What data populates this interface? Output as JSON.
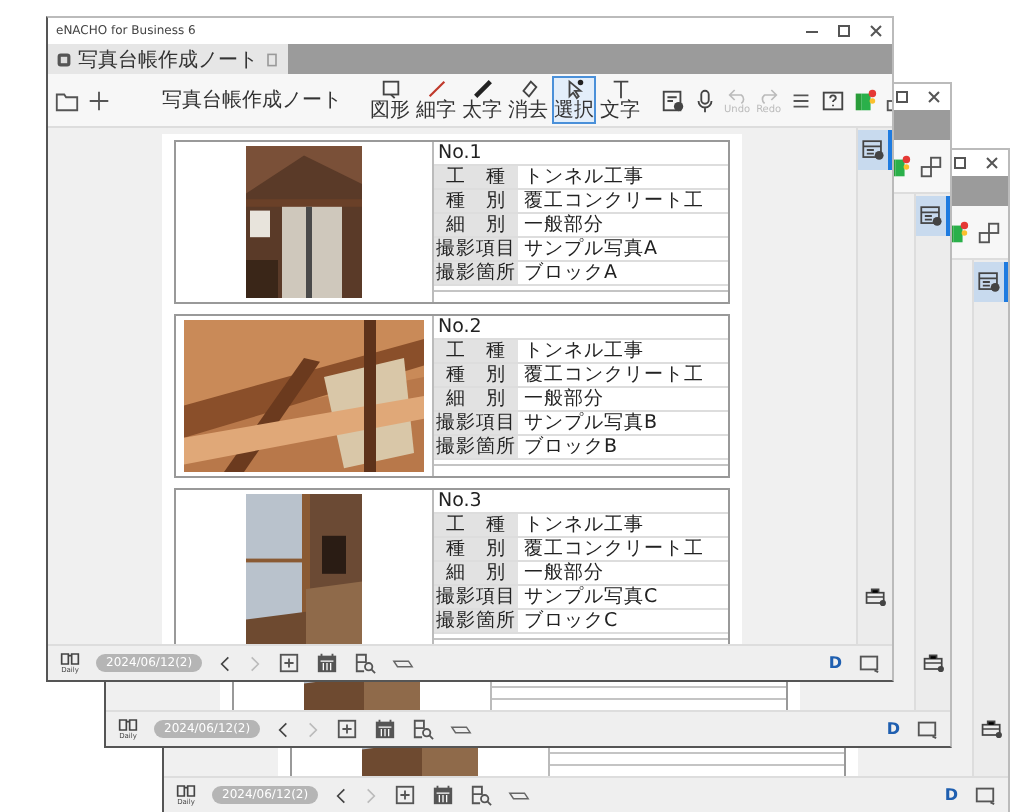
{
  "app_title": "eNACHO for Business 6",
  "tab": {
    "label": "写真台帳作成ノート"
  },
  "toolbar": {
    "title": "写真台帳作成ノート",
    "tools": [
      {
        "label": "図形",
        "selected": false
      },
      {
        "label": "細字",
        "selected": false
      },
      {
        "label": "太字",
        "selected": false
      },
      {
        "label": "消去",
        "selected": false
      },
      {
        "label": "選択",
        "selected": true
      },
      {
        "label": "文字",
        "selected": false
      }
    ],
    "undo": {
      "label": "Undo",
      "disabled": true
    },
    "redo": {
      "label": "Redo",
      "disabled": true
    }
  },
  "sheets": [
    {
      "number": "No.1",
      "fields": [
        {
          "label": "工　種",
          "value": "トンネル工事"
        },
        {
          "label": "種　別",
          "value": "覆工コンクリート工"
        },
        {
          "label": "細　別",
          "value": "一般部分"
        },
        {
          "label": "撮影項目",
          "value": "サンプル写真A"
        },
        {
          "label": "撮影箇所",
          "value": "ブロックA"
        }
      ]
    },
    {
      "number": "No.2",
      "fields": [
        {
          "label": "工　種",
          "value": "トンネル工事"
        },
        {
          "label": "種　別",
          "value": "覆工コンクリート工"
        },
        {
          "label": "細　別",
          "value": "一般部分"
        },
        {
          "label": "撮影項目",
          "value": "サンプル写真B"
        },
        {
          "label": "撮影箇所",
          "value": "ブロックB"
        }
      ]
    },
    {
      "number": "No.3",
      "fields": [
        {
          "label": "工　種",
          "value": "トンネル工事"
        },
        {
          "label": "種　別",
          "value": "覆工コンクリート工"
        },
        {
          "label": "細　別",
          "value": "一般部分"
        },
        {
          "label": "撮影項目",
          "value": "サンプル写真C"
        },
        {
          "label": "撮影箇所",
          "value": "ブロックC"
        }
      ]
    }
  ],
  "sidebar_item_selected": true,
  "bottom_bar": {
    "daily_label": "Daily",
    "date": "2024/06/12(2)",
    "prev_disabled": false,
    "next_disabled": true,
    "mode_label": "D"
  },
  "back_windows": [
    {
      "sidebar_item_selected": true,
      "bottom_bar": {
        "daily_label": "Daily",
        "date": "2024/06/12(2)",
        "prev_disabled": false,
        "next_disabled": true,
        "mode_label": "D"
      }
    },
    {
      "sidebar_item_selected": true,
      "bottom_bar": {
        "daily_label": "Daily",
        "date": "2024/06/12(2)",
        "prev_disabled": false,
        "next_disabled": true,
        "mode_label": "D"
      }
    }
  ]
}
